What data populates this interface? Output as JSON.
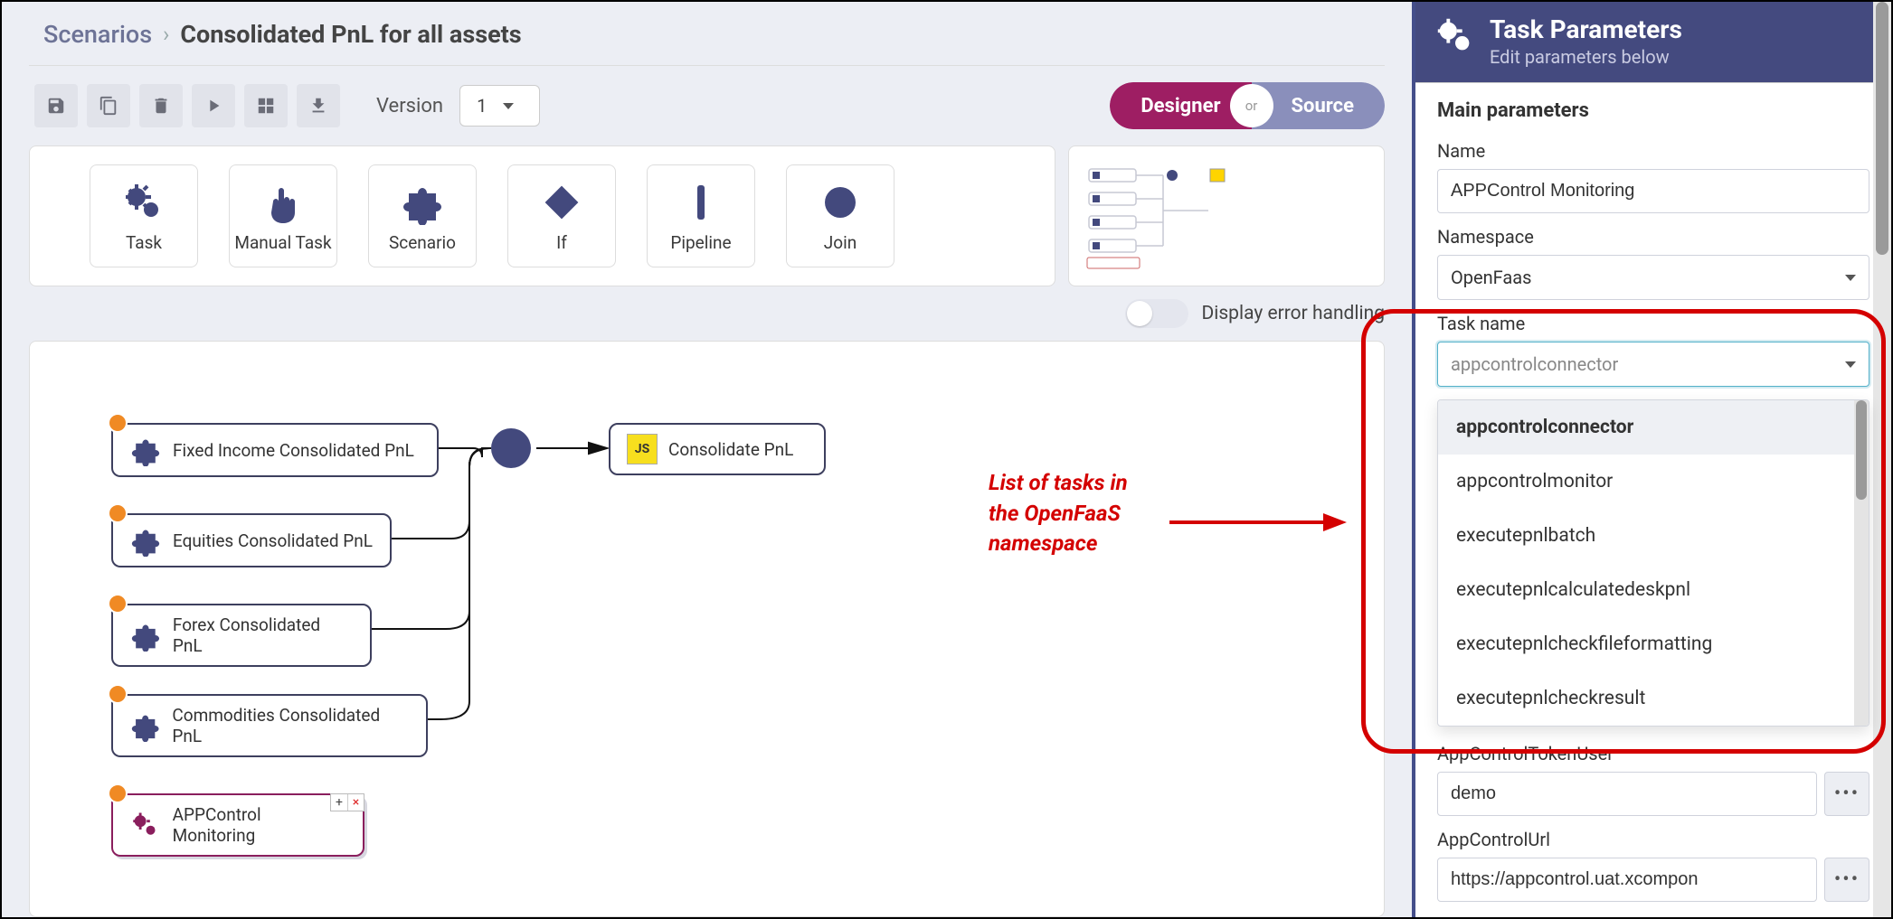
{
  "breadcrumb": {
    "root": "Scenarios",
    "current": "Consolidated PnL for all assets"
  },
  "toolbar": {
    "version_label": "Version",
    "version_value": "1",
    "mode": {
      "left": "Designer",
      "mid": "or",
      "right": "Source"
    }
  },
  "palette": [
    {
      "id": "task",
      "label": "Task"
    },
    {
      "id": "manual-task",
      "label": "Manual Task"
    },
    {
      "id": "scenario",
      "label": "Scenario"
    },
    {
      "id": "if",
      "label": "If"
    },
    {
      "id": "pipeline",
      "label": "Pipeline"
    },
    {
      "id": "join",
      "label": "Join"
    }
  ],
  "display_error_label": "Display error handling",
  "canvas": {
    "nodes": {
      "fi": "Fixed Income Consolidated PnL",
      "eq": "Equities Consolidated PnL",
      "fx": "Forex Consolidated PnL",
      "cm": "Commodities Consolidated PnL",
      "cons": "Consolidate PnL",
      "mon": "APPControl Monitoring"
    }
  },
  "annotation": {
    "line1": "List of tasks in",
    "line2": "the OpenFaaS",
    "line3": "namespace"
  },
  "side": {
    "title": "Task Parameters",
    "subtitle": "Edit parameters below",
    "section": "Main parameters",
    "fields": {
      "name_label": "Name",
      "name_value": "APPControl Monitoring",
      "ns_label": "Namespace",
      "ns_value": "OpenFaas",
      "taskname_label": "Task name",
      "taskname_placeholder": "appcontrolconnector",
      "tokenuser_label": "AppControlTokenUser",
      "tokenuser_value": "demo",
      "url_label": "AppControlUrl",
      "url_value": "https://appcontrol.uat.xcompon"
    },
    "dropdown": [
      "appcontrolconnector",
      "appcontrolmonitor",
      "executepnlbatch",
      "executepnlcalculatedeskpnl",
      "executepnlcheckfileformatting",
      "executepnlcheckresult"
    ]
  }
}
